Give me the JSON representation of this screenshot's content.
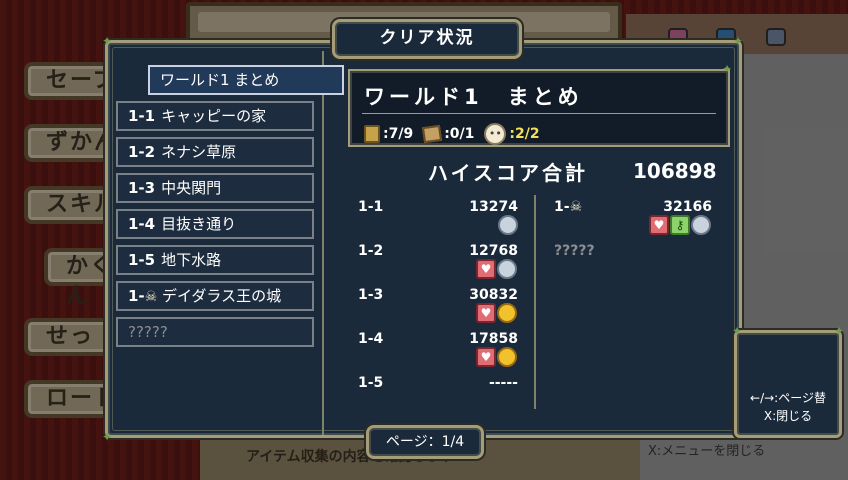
{
  "background": {
    "left_buttons": [
      "セーブ",
      "ずかん",
      "スキル",
      "かくにん",
      "せっ",
      "ロード"
    ],
    "bottom_text": "アイテム収集の内容を確認します",
    "bottom_right_text": "X:メニューを閉じる"
  },
  "dialog": {
    "title": "クリア状況",
    "stages": [
      {
        "num": "",
        "name": "ワールド1 まとめ",
        "selected": true
      },
      {
        "num": "1-1",
        "name": "キャッピーの家"
      },
      {
        "num": "1-2",
        "name": "ネナシ草原"
      },
      {
        "num": "1-3",
        "name": "中央関門"
      },
      {
        "num": "1-4",
        "name": "目抜き通り"
      },
      {
        "num": "1-5",
        "name": "地下水路"
      },
      {
        "num": "1-",
        "name": "デイダラス王の城",
        "skull": true
      },
      {
        "num": "",
        "name": "?????",
        "locked": true
      }
    ],
    "summary": {
      "title": "ワールド1　まとめ",
      "books": ":7/9",
      "maps": ":0/1",
      "npcs": ":2/2"
    },
    "highscore_label": "ハイスコア合計",
    "highscore_value": "106898",
    "scores_left": [
      {
        "stage": "1-1",
        "score": "13274",
        "icons": [
          "silver"
        ]
      },
      {
        "stage": "1-2",
        "score": "12768",
        "icons": [
          "heart",
          "silver"
        ]
      },
      {
        "stage": "1-3",
        "score": "30832",
        "icons": [
          "heart",
          "gold"
        ]
      },
      {
        "stage": "1-4",
        "score": "17858",
        "icons": [
          "heart",
          "gold"
        ]
      },
      {
        "stage": "1-5",
        "score": "-----",
        "icons": []
      }
    ],
    "scores_right": [
      {
        "stage": "1-",
        "skull": true,
        "score": "32166",
        "icons": [
          "heart",
          "key",
          "silver"
        ]
      },
      {
        "stage": "?????",
        "locked": true,
        "score": "",
        "icons": []
      }
    ],
    "page_label": "ページ：1/4"
  },
  "help": {
    "line1": "←/→:ページ替",
    "line2": "X:閉じる"
  },
  "colors": {
    "panel_bg": "#1b2a3b",
    "border_gold": "#a59c7a",
    "highlight_yellow": "#f3e15c"
  }
}
